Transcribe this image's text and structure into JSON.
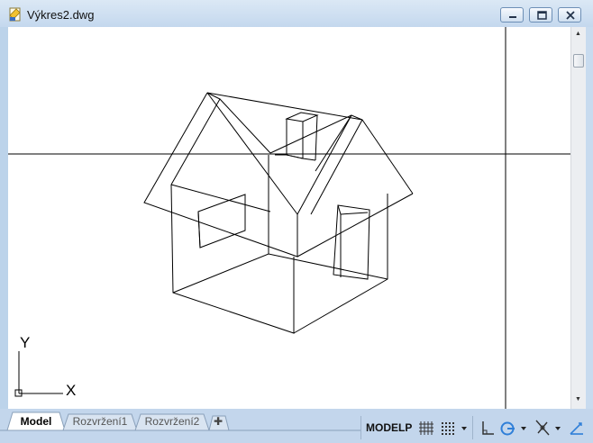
{
  "window": {
    "title": "Výkres2.dwg",
    "icon": "dwg-file-icon"
  },
  "window_buttons": [
    "minimize-icon",
    "restore-icon",
    "close-icon"
  ],
  "ucs": {
    "x_label": "X",
    "y_label": "Y"
  },
  "layout_tabs": [
    {
      "label": "Model",
      "active": true
    },
    {
      "label": "Rozvržení1",
      "active": false
    },
    {
      "label": "Rozvržení2",
      "active": false
    }
  ],
  "statusbar": {
    "space_label": "MODELP",
    "icons": [
      "grid-display-icon",
      "snap-mode-icon",
      "ortho-mode-icon",
      "polar-tracking-icon",
      "object-snap-icon",
      "dynamic-ucs-icon"
    ]
  },
  "colors": {
    "titlebar": "#c4d8ee",
    "statusbar": "#c3d6ec",
    "drawing_bg": "#ffffff",
    "linework": "#000000"
  }
}
